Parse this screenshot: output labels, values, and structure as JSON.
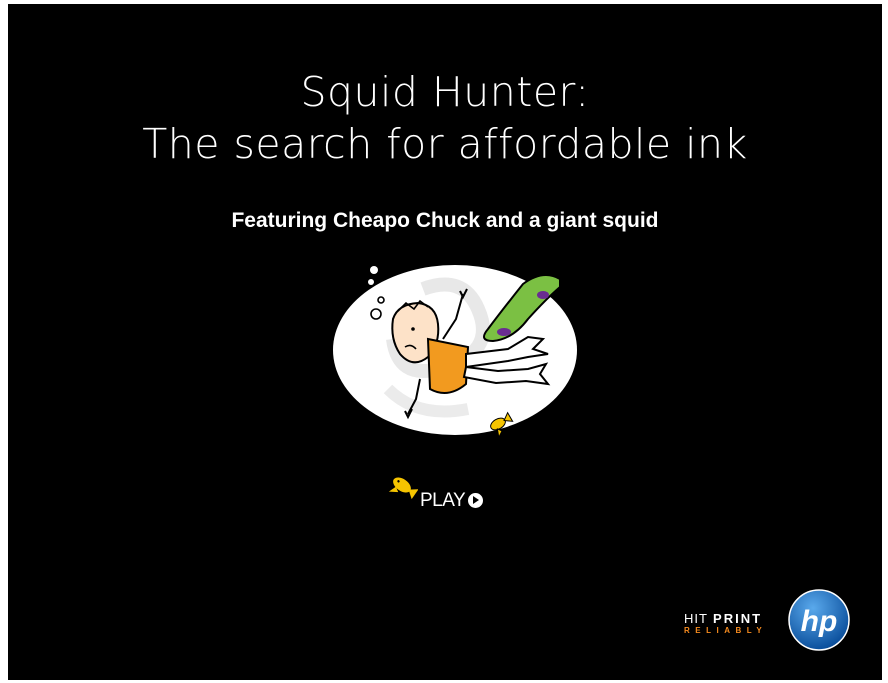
{
  "title": {
    "line1": "Squid Hunter:",
    "line2": "The search for affordable ink"
  },
  "subtitle": "Featuring Cheapo Chuck and a giant squid",
  "play_button": {
    "label": "PLAY",
    "icon": "play-circle-icon"
  },
  "brand": {
    "hit": "HIT",
    "print": "PRINT",
    "reliably": "RELIABLY",
    "logo_text": "hp",
    "accent_color": "#f68b1f",
    "logo_color": "#1a6fc4"
  },
  "colors": {
    "background": "#000000",
    "fish": "#f5c400",
    "life_vest": "#f29a1f",
    "tentacle": "#7bc043"
  }
}
